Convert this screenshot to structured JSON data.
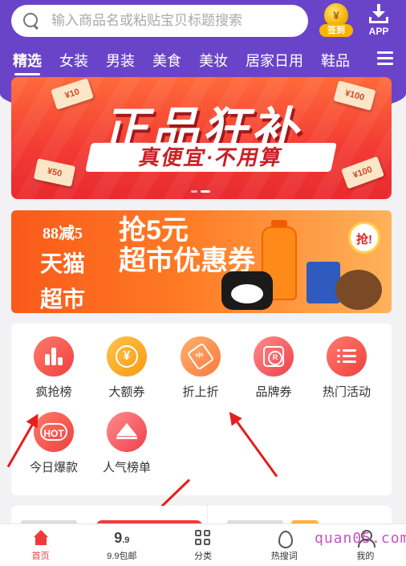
{
  "header": {
    "search_placeholder": "输入商品名或粘贴宝贝标题搜索",
    "signin_label": "签到",
    "signin_coin_glyph": "¥",
    "app_label": "APP"
  },
  "tabs": [
    {
      "label": "精选",
      "active": true
    },
    {
      "label": "女装",
      "active": false
    },
    {
      "label": "男装",
      "active": false
    },
    {
      "label": "美食",
      "active": false
    },
    {
      "label": "美妆",
      "active": false
    },
    {
      "label": "居家日用",
      "active": false
    },
    {
      "label": "鞋品",
      "active": false
    }
  ],
  "banner1": {
    "title": "正品狂补",
    "subtitle": "真便宜·不用算",
    "coupons": [
      "¥10",
      "¥100",
      "¥50",
      "¥100"
    ]
  },
  "banner2": {
    "line1": "88减5",
    "line2": "天猫",
    "line3": "超市",
    "title_line1": "抢5元",
    "title_line2": "超市优惠券",
    "grab_label": "抢!"
  },
  "grid": {
    "items": [
      {
        "label": "疯抢榜",
        "icon": "bar-chart-icon"
      },
      {
        "label": "大额券",
        "icon": "yen-coin-icon"
      },
      {
        "label": "折上折",
        "icon": "discount-tag-icon"
      },
      {
        "label": "品牌券",
        "icon": "brand-icon"
      },
      {
        "label": "热门活动",
        "icon": "list-icon"
      },
      {
        "label": "今日爆款",
        "icon": "hot-icon"
      },
      {
        "label": "人气榜单",
        "icon": "crown-icon"
      }
    ],
    "hot_text": "HOT",
    "yen_glyph": "¥",
    "tag_glyph": "%"
  },
  "bottom_nav": {
    "items": [
      {
        "label": "首页",
        "icon": "home-icon",
        "active": true
      },
      {
        "label": "9.9包邮",
        "icon": "nine-nine-icon",
        "active": false
      },
      {
        "label": "分类",
        "icon": "category-grid-icon",
        "active": false
      },
      {
        "label": "热搜词",
        "icon": "fire-icon",
        "active": false
      },
      {
        "label": "我的",
        "icon": "user-icon",
        "active": false
      }
    ],
    "nine_big": "9",
    "nine_small": ".9"
  },
  "watermark": "quan05.com",
  "colors": {
    "header_purple": "#6a44c8",
    "accent_red": "#f03a3a",
    "arrow_red": "#e81c1c"
  }
}
